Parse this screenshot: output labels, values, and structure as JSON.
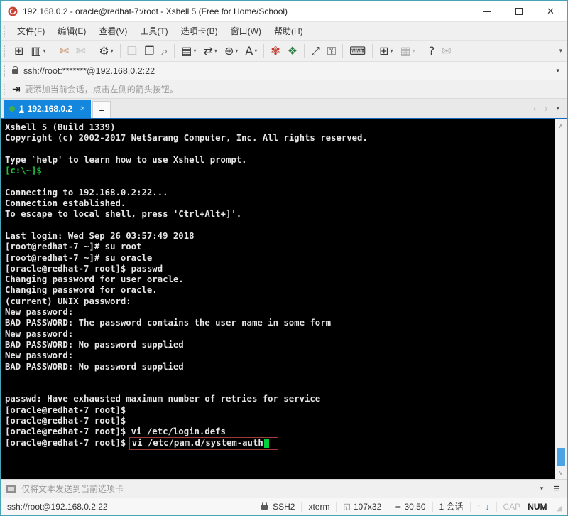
{
  "window": {
    "title": "192.168.0.2 - oracle@redhat-7:/root - Xshell 5 (Free for Home/School)",
    "close_glyph": "✕"
  },
  "menu": {
    "items": [
      {
        "label": "文件(F)"
      },
      {
        "label": "编辑(E)"
      },
      {
        "label": "查看(V)"
      },
      {
        "label": "工具(T)"
      },
      {
        "label": "选项卡(B)"
      },
      {
        "label": "窗口(W)"
      },
      {
        "label": "帮助(H)"
      }
    ]
  },
  "toolbar": {
    "overflow_glyph": "▾",
    "items": [
      {
        "name": "new-session-icon",
        "glyph": "⊞"
      },
      {
        "name": "open-folder-icon",
        "glyph": "▥",
        "dropdown": true
      },
      {
        "type": "divider"
      },
      {
        "name": "disconnect-icon",
        "glyph": "✄",
        "class": "orange"
      },
      {
        "name": "reconnect-icon",
        "glyph": "✄",
        "disabled": true
      },
      {
        "type": "divider"
      },
      {
        "name": "session-properties-icon",
        "glyph": "⚙",
        "dropdown": true
      },
      {
        "type": "divider"
      },
      {
        "name": "duplicate-session-icon",
        "glyph": "❏",
        "disabled": true
      },
      {
        "name": "paste-icon",
        "glyph": "❐"
      },
      {
        "name": "find-icon",
        "glyph": "⌕"
      },
      {
        "type": "divider"
      },
      {
        "name": "print-icon",
        "glyph": "▤",
        "dropdown": true
      },
      {
        "name": "encoding-icon",
        "glyph": "⇄",
        "dropdown": true
      },
      {
        "name": "web-browser-icon",
        "glyph": "⊕",
        "dropdown": true
      },
      {
        "name": "font-icon",
        "glyph": "A",
        "dropdown": true
      },
      {
        "type": "divider"
      },
      {
        "name": "xshell-icon",
        "glyph": "✾",
        "class": "red"
      },
      {
        "name": "xftp-icon",
        "glyph": "❖",
        "class": "green"
      },
      {
        "type": "divider"
      },
      {
        "name": "fullscreen-icon",
        "glyph": "⤢"
      },
      {
        "name": "lock-screen-icon",
        "glyph": "⚿"
      },
      {
        "type": "divider"
      },
      {
        "name": "virtual-keyboard-icon",
        "glyph": "⌨"
      },
      {
        "type": "divider"
      },
      {
        "name": "new-tab-icon",
        "glyph": "⊞",
        "dropdown": true
      },
      {
        "name": "arrange-tabs-icon",
        "glyph": "▦",
        "dropdown": true,
        "disabled": true
      },
      {
        "type": "divider"
      },
      {
        "name": "help-icon",
        "glyph": "?"
      },
      {
        "name": "feedback-icon",
        "glyph": "✉",
        "disabled": true
      }
    ]
  },
  "address_bar": {
    "value": "ssh://root:*******@192.168.0.2:22",
    "caret": "▾"
  },
  "info_bar": {
    "icon_glyph": "⇥",
    "message": "要添加当前会话，点击左侧的箭头按钮。"
  },
  "tab_bar": {
    "active_tab": {
      "number": "1",
      "label": "192.168.0.2",
      "close_glyph": "✕"
    },
    "new_tab_label": "+",
    "nav_left": "‹",
    "nav_right": "›",
    "menu_caret": "▾"
  },
  "terminal": {
    "scroll_up_glyph": "∧",
    "scroll_down_glyph": "∨",
    "lines": [
      {
        "text": "Xshell 5 (Build 1339)"
      },
      {
        "text": "Copyright (c) 2002-2017 NetSarang Computer, Inc. All rights reserved."
      },
      {
        "text": ""
      },
      {
        "text": "Type `help' to learn how to use Xshell prompt."
      },
      {
        "text": "[c:\\~]$",
        "class": "green"
      },
      {
        "text": ""
      },
      {
        "text": "Connecting to 192.168.0.2:22..."
      },
      {
        "text": "Connection established."
      },
      {
        "text": "To escape to local shell, press 'Ctrl+Alt+]'."
      },
      {
        "text": ""
      },
      {
        "text": "Last login: Wed Sep 26 03:57:49 2018"
      },
      {
        "text": "[root@redhat-7 ~]# su root"
      },
      {
        "text": "[root@redhat-7 ~]# su oracle"
      },
      {
        "text": "[oracle@redhat-7 root]$ passwd"
      },
      {
        "text": "Changing password for user oracle."
      },
      {
        "text": "Changing password for oracle."
      },
      {
        "text": "(current) UNIX password:"
      },
      {
        "text": "New password:"
      },
      {
        "text": "BAD PASSWORD: The password contains the user name in some form"
      },
      {
        "text": "New password:"
      },
      {
        "text": "BAD PASSWORD: No password supplied"
      },
      {
        "text": "New password:"
      },
      {
        "text": "BAD PASSWORD: No password supplied"
      },
      {
        "text": ""
      },
      {
        "text": ""
      },
      {
        "text": "passwd: Have exhausted maximum number of retries for service"
      },
      {
        "text": "[oracle@redhat-7 root]$"
      },
      {
        "text": "[oracle@redhat-7 root]$"
      },
      {
        "text": "[oracle@redhat-7 root]$ vi /etc/login.defs"
      }
    ],
    "final_line": {
      "prompt": "[oracle@redhat-7 root]$ ",
      "command": "vi /etc/pam.d/system-auth"
    }
  },
  "send_bar": {
    "placeholder": "仅将文本发送到当前选项卡",
    "caret": "▾",
    "list_glyph": "≡"
  },
  "status_bar": {
    "url": "ssh://root@192.168.0.2:22",
    "protocol": "SSH2",
    "emulation": "xterm",
    "terminal_size": "107x32",
    "cursor_position": "30,50",
    "session_count": "1 会话",
    "caps_lock": "CAP",
    "num_lock": "NUM",
    "size_icon_glyph": "◱",
    "position_icon_glyph": "≡",
    "arrow_up": "↑",
    "arrow_down": "↓",
    "grip_glyph": "◢"
  },
  "colors": {
    "window_border": "#48a4b4",
    "tab_active_blue": "#1386dd",
    "tab_status_dot_green": "#3fae49",
    "terminal_background": "#000000",
    "terminal_text": "#e6e6e6",
    "terminal_green": "#21c03c",
    "cursor_green": "#00d23c",
    "highlight_box_border": "#9e3a38",
    "xshell_brand_red": "#c0392b",
    "scroll_thumb_blue": "#4ba3e3"
  }
}
